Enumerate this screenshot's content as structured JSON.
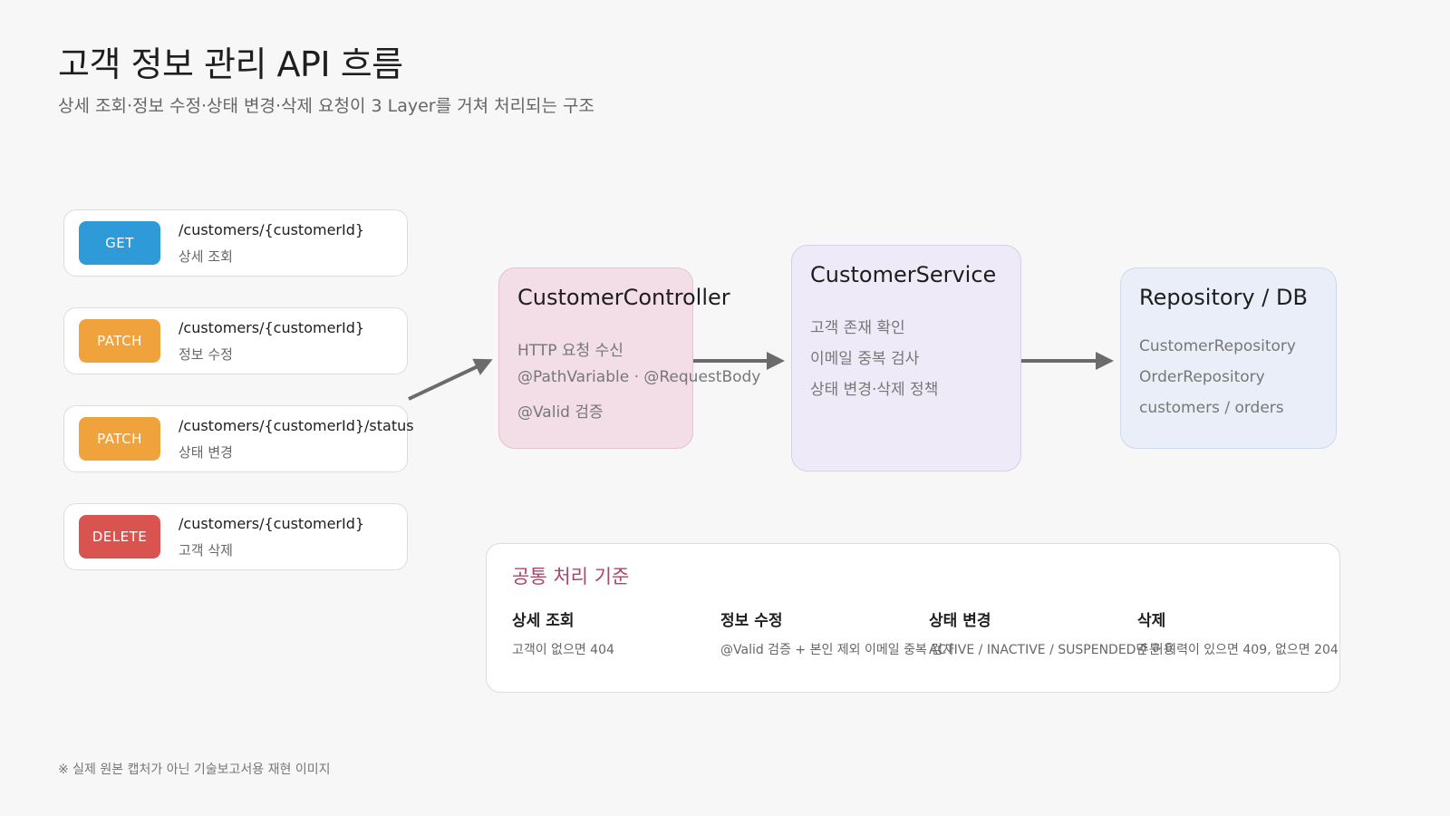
{
  "header": {
    "title": "고객 정보 관리 API 흐름",
    "subtitle": "상세 조회·정보 수정·상태 변경·삭제 요청이 3 Layer를 거쳐 처리되는 구조"
  },
  "endpoints": [
    {
      "method": "GET",
      "path": "/customers/{customerId}",
      "desc": "상세 조회",
      "color": "#2e9ad8"
    },
    {
      "method": "PATCH",
      "path": "/customers/{customerId}",
      "desc": "정보 수정",
      "color": "#f0a33d"
    },
    {
      "method": "PATCH",
      "path": "/customers/{customerId}/status",
      "desc": "상태 변경",
      "color": "#f0a33d"
    },
    {
      "method": "DELETE",
      "path": "/customers/{customerId}",
      "desc": "고객 삭제",
      "color": "#d9534f"
    }
  ],
  "layers": {
    "controller": {
      "title": "CustomerController",
      "items": [
        "HTTP 요청 수신",
        "@PathVariable · @RequestBody",
        "@Valid 검증"
      ],
      "color": "#f3dde7"
    },
    "service": {
      "title": "CustomerService",
      "items": [
        "고객 존재 확인",
        "이메일 중복 검사",
        "상태 변경·삭제 정책"
      ],
      "color": "#efeaf8"
    },
    "repository": {
      "title": "Repository / DB",
      "items": [
        "CustomerRepository",
        "OrderRepository",
        "customers / orders"
      ],
      "color": "#e9eef9"
    }
  },
  "policy": {
    "title": "공통 처리 기준",
    "columns": [
      {
        "head": "상세 조회",
        "text": "고객이 없으면 404"
      },
      {
        "head": "정보 수정",
        "text": "@Valid 검증 + 본인 제외 이메일 중복 검사"
      },
      {
        "head": "상태 변경",
        "text": "ACTIVE / INACTIVE / SUSPENDED만 허용"
      },
      {
        "head": "삭제",
        "text": "주문 이력이 있으면 409, 없으면 204"
      }
    ]
  },
  "footnote": "※ 실제 원본 캡처가 아닌 기술보고서용 재현 이미지"
}
